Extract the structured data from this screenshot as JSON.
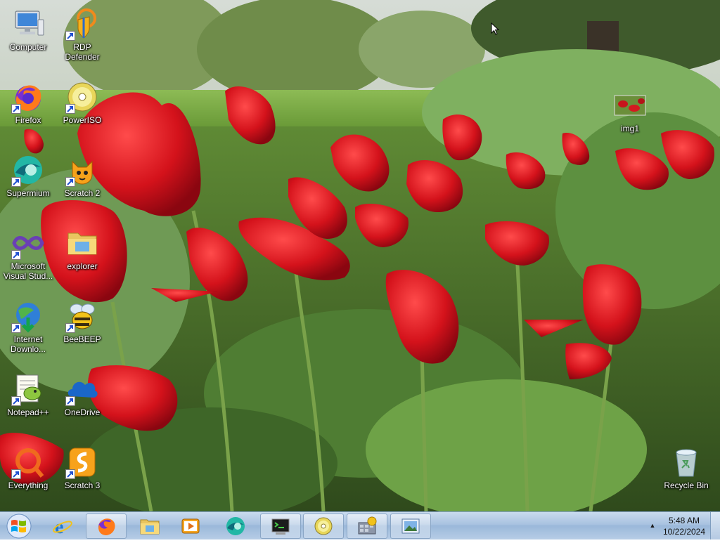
{
  "desktop": {
    "icons": [
      {
        "label": "Computer",
        "icon": "computer-icon",
        "shortcut": false
      },
      {
        "label": "RDP Defender",
        "icon": "rdp-defender-icon",
        "shortcut": true
      },
      {
        "label": "Firefox",
        "icon": "firefox-icon",
        "shortcut": true
      },
      {
        "label": "PowerISO",
        "icon": "poweriso-icon",
        "shortcut": true
      },
      {
        "label": "Supermium",
        "icon": "supermium-icon",
        "shortcut": true
      },
      {
        "label": "Scratch 2",
        "icon": "scratch2-icon",
        "shortcut": true
      },
      {
        "label": "Microsoft Visual Stud...",
        "icon": "visual-studio-icon",
        "shortcut": true
      },
      {
        "label": "explorer",
        "icon": "folder-icon",
        "shortcut": false
      },
      {
        "label": "Internet Downlo...",
        "icon": "internet-download-manager-icon",
        "shortcut": true
      },
      {
        "label": "BeeBEEP",
        "icon": "beebeep-icon",
        "shortcut": true
      },
      {
        "label": "Notepad++",
        "icon": "notepad-plus-plus-icon",
        "shortcut": true
      },
      {
        "label": "OneDrive",
        "icon": "onedrive-icon",
        "shortcut": true
      },
      {
        "label": "Everything",
        "icon": "everything-icon",
        "shortcut": true
      },
      {
        "label": "Scratch 3",
        "icon": "scratch3-icon",
        "shortcut": true
      },
      {
        "label": "img1",
        "icon": "image-file-icon",
        "shortcut": false
      },
      {
        "label": "Recycle Bin",
        "icon": "recycle-bin-icon",
        "shortcut": false
      }
    ]
  },
  "taskbar": {
    "pinned": [
      {
        "icon": "internet-explorer-icon",
        "active": false
      },
      {
        "icon": "firefox-icon",
        "active": true
      },
      {
        "icon": "file-explorer-icon",
        "active": false
      },
      {
        "icon": "media-player-icon",
        "active": false
      },
      {
        "icon": "supermium-icon",
        "active": false
      },
      {
        "icon": "terminal-icon",
        "active": true
      },
      {
        "icon": "poweriso-icon",
        "active": true
      },
      {
        "icon": "network-tool-icon",
        "active": true
      },
      {
        "icon": "image-viewer-icon",
        "active": true
      }
    ],
    "clock": {
      "time": "5:48 AM",
      "date": "10/22/2024"
    }
  },
  "colors": {
    "taskbar": "#a8c2e0",
    "tulip_red": "#d8141c",
    "grass": "#6f9b3e"
  }
}
